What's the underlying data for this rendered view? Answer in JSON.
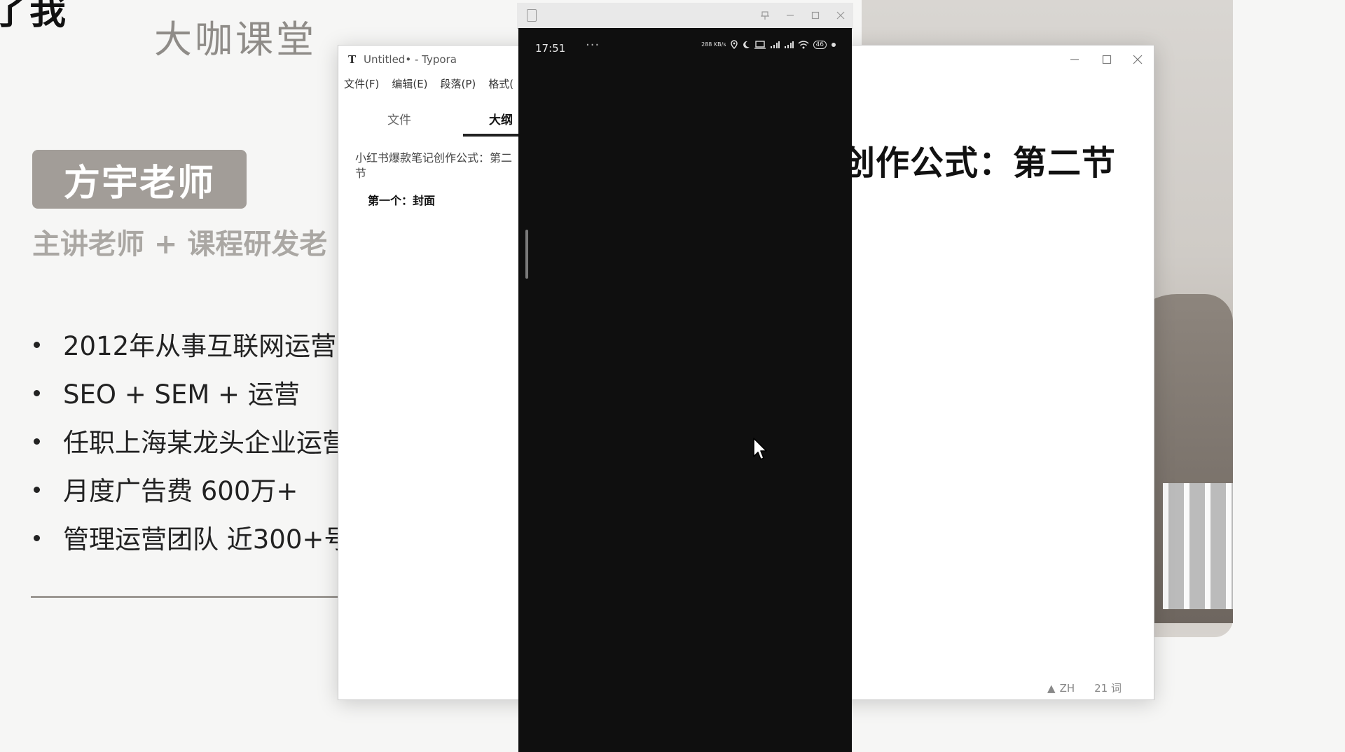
{
  "slide": {
    "title_fragment": "了我",
    "brand": "大咖课堂",
    "teacher_badge": "方宇老师",
    "teacher_subtitle": "主讲老师 + 课程研发老",
    "bullets": [
      "2012年从事互联网运营",
      "SEO + SEM + 运营",
      "任职上海某龙头企业运营",
      "月度广告费 600万+",
      "管理运营团队 近300+号"
    ]
  },
  "typora": {
    "app_icon": "T",
    "title": "Untitled• - Typora",
    "menu": [
      "文件(F)",
      "编辑(E)",
      "段落(P)",
      "格式("
    ],
    "sidebar_tabs": [
      "文件",
      "大纲"
    ],
    "active_tab": "大纲",
    "outline": {
      "h1": "小红书爆款笔记创作公式：第二节",
      "h2": "第一个：封面"
    },
    "document_heading": "创作公式：第二节",
    "status_lang": "ZH",
    "status_words": "21 词",
    "window_buttons": [
      "minimize-icon",
      "maximize-icon",
      "close-icon"
    ]
  },
  "mirror": {
    "title_buttons": [
      "pin-icon",
      "minimize-icon",
      "maximize-icon",
      "close-icon"
    ],
    "phone": {
      "time": "17:51",
      "more": "···",
      "status_icons": [
        "network-speed-icon",
        "location-icon",
        "moon-icon",
        "laptop-icon",
        "signal-icon",
        "signal-icon",
        "wifi-icon",
        "battery-icon"
      ],
      "network_speed": "288 KB/s",
      "battery": "46"
    }
  }
}
